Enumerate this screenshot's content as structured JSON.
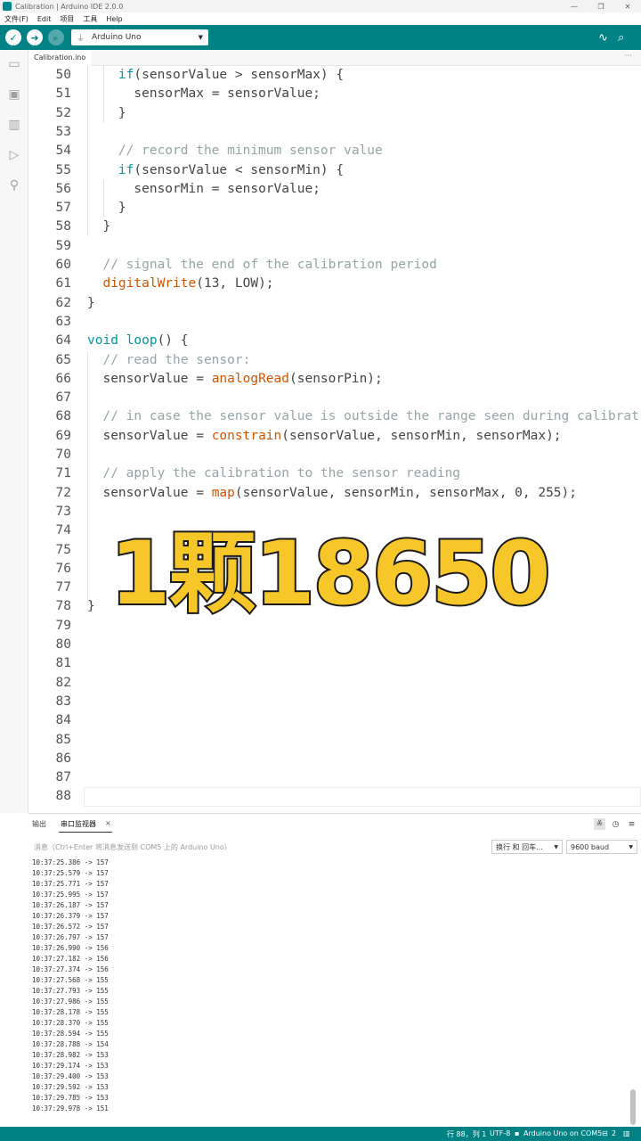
{
  "window": {
    "title": "Calibration | Arduino IDE 2.0.0"
  },
  "menu": [
    "文件(F)",
    "Edit",
    "项目",
    "工具",
    "Help"
  ],
  "toolbar": {
    "board": "Arduino Uno"
  },
  "editor": {
    "tab": "Calibration.ino",
    "lines": [
      {
        "n": "50",
        "indent": "    ",
        "parts": [
          [
            "kw",
            "if"
          ],
          [
            "",
            "(sensorValue > sensorMax) {"
          ]
        ]
      },
      {
        "n": "51",
        "indent": "      ",
        "parts": [
          [
            "",
            "sensorMax = sensorValue;"
          ]
        ]
      },
      {
        "n": "52",
        "indent": "    ",
        "parts": [
          [
            "",
            "}"
          ]
        ]
      },
      {
        "n": "53",
        "indent": "",
        "parts": []
      },
      {
        "n": "54",
        "indent": "    ",
        "parts": [
          [
            "cm",
            "// record the minimum sensor value"
          ]
        ]
      },
      {
        "n": "55",
        "indent": "    ",
        "parts": [
          [
            "kw",
            "if"
          ],
          [
            "",
            "(sensorValue < sensorMin) {"
          ]
        ]
      },
      {
        "n": "56",
        "indent": "      ",
        "parts": [
          [
            "",
            "sensorMin = sensorValue;"
          ]
        ]
      },
      {
        "n": "57",
        "indent": "    ",
        "parts": [
          [
            "",
            "}"
          ]
        ]
      },
      {
        "n": "58",
        "indent": "  ",
        "parts": [
          [
            "",
            "}"
          ]
        ]
      },
      {
        "n": "59",
        "indent": "",
        "parts": []
      },
      {
        "n": "60",
        "indent": "  ",
        "parts": [
          [
            "cm",
            "// signal the end of the calibration period"
          ]
        ]
      },
      {
        "n": "61",
        "indent": "  ",
        "parts": [
          [
            "fn",
            "digitalWrite"
          ],
          [
            "",
            "(13, LOW);"
          ]
        ]
      },
      {
        "n": "62",
        "indent": "",
        "parts": [
          [
            "",
            "}"
          ]
        ]
      },
      {
        "n": "63",
        "indent": "",
        "parts": []
      },
      {
        "n": "64",
        "indent": "",
        "parts": [
          [
            "kw",
            "void"
          ],
          [
            "",
            " "
          ],
          [
            "kw",
            "loop"
          ],
          [
            "",
            "() {"
          ]
        ]
      },
      {
        "n": "65",
        "indent": "  ",
        "parts": [
          [
            "cm",
            "// read the sensor:"
          ]
        ]
      },
      {
        "n": "66",
        "indent": "  ",
        "parts": [
          [
            "",
            "sensorValue = "
          ],
          [
            "fn",
            "analogRead"
          ],
          [
            "",
            "(sensorPin);"
          ]
        ]
      },
      {
        "n": "67",
        "indent": "",
        "parts": []
      },
      {
        "n": "68",
        "indent": "  ",
        "parts": [
          [
            "cm",
            "// in case the sensor value is outside the range seen during calibrat"
          ]
        ]
      },
      {
        "n": "69",
        "indent": "  ",
        "parts": [
          [
            "",
            "sensorValue = "
          ],
          [
            "fn",
            "constrain"
          ],
          [
            "",
            "(sensorValue, sensorMin, sensorMax);"
          ]
        ]
      },
      {
        "n": "70",
        "indent": "",
        "parts": []
      },
      {
        "n": "71",
        "indent": "  ",
        "parts": [
          [
            "cm",
            "// apply the calibration to the sensor reading"
          ]
        ]
      },
      {
        "n": "72",
        "indent": "  ",
        "parts": [
          [
            "",
            "sensorValue = "
          ],
          [
            "fn",
            "map"
          ],
          [
            "",
            "(sensorValue, sensorMin, sensorMax, 0, 255);"
          ]
        ]
      },
      {
        "n": "73",
        "indent": "",
        "parts": []
      },
      {
        "n": "74",
        "indent": "",
        "parts": []
      },
      {
        "n": "75",
        "indent": "",
        "parts": []
      },
      {
        "n": "76",
        "indent": "",
        "parts": []
      },
      {
        "n": "77",
        "indent": "",
        "parts": []
      },
      {
        "n": "78",
        "indent": "",
        "parts": [
          [
            "",
            "}"
          ]
        ]
      },
      {
        "n": "79",
        "indent": "",
        "parts": []
      },
      {
        "n": "80",
        "indent": "",
        "parts": []
      },
      {
        "n": "81",
        "indent": "",
        "parts": []
      },
      {
        "n": "82",
        "indent": "",
        "parts": []
      },
      {
        "n": "83",
        "indent": "",
        "parts": []
      },
      {
        "n": "84",
        "indent": "",
        "parts": []
      },
      {
        "n": "85",
        "indent": "",
        "parts": []
      },
      {
        "n": "86",
        "indent": "",
        "parts": []
      },
      {
        "n": "87",
        "indent": "",
        "parts": []
      },
      {
        "n": "88",
        "indent": "",
        "parts": []
      }
    ]
  },
  "overlay_caption": "1颗18650",
  "panel": {
    "tab_output": "输出",
    "tab_serial": "串口监视器",
    "close_glyph": "×",
    "message_placeholder": "消息（Ctrl+Enter 将消息发送到 COM5 上的 Arduino Uno）",
    "line_ending": "换行 和 回车...",
    "baud": "9600 baud",
    "log": [
      "10:37:25.386 -> 157",
      "10:37:25.579 -> 157",
      "10:37:25.771 -> 157",
      "10:37:25.995 -> 157",
      "10:37:26.187 -> 157",
      "10:37:26.379 -> 157",
      "10:37:26.572 -> 157",
      "10:37:26.797 -> 157",
      "10:37:26.990 -> 156",
      "10:37:27.182 -> 156",
      "10:37:27.374 -> 156",
      "10:37:27.568 -> 155",
      "10:37:27.793 -> 155",
      "10:37:27.986 -> 155",
      "10:37:28.178 -> 155",
      "10:37:28.370 -> 155",
      "10:37:28.594 -> 155",
      "10:37:28.788 -> 154",
      "10:37:28.982 -> 153",
      "10:37:29.174 -> 153",
      "10:37:29.400 -> 153",
      "10:37:29.592 -> 153",
      "10:37:29.785 -> 153",
      "10:37:29.978 -> 151"
    ]
  },
  "statusbar": {
    "position": "行 88，列 1",
    "encoding": "UTF-8",
    "board_port": "Arduino Uno on COM5",
    "notifications": "2"
  }
}
